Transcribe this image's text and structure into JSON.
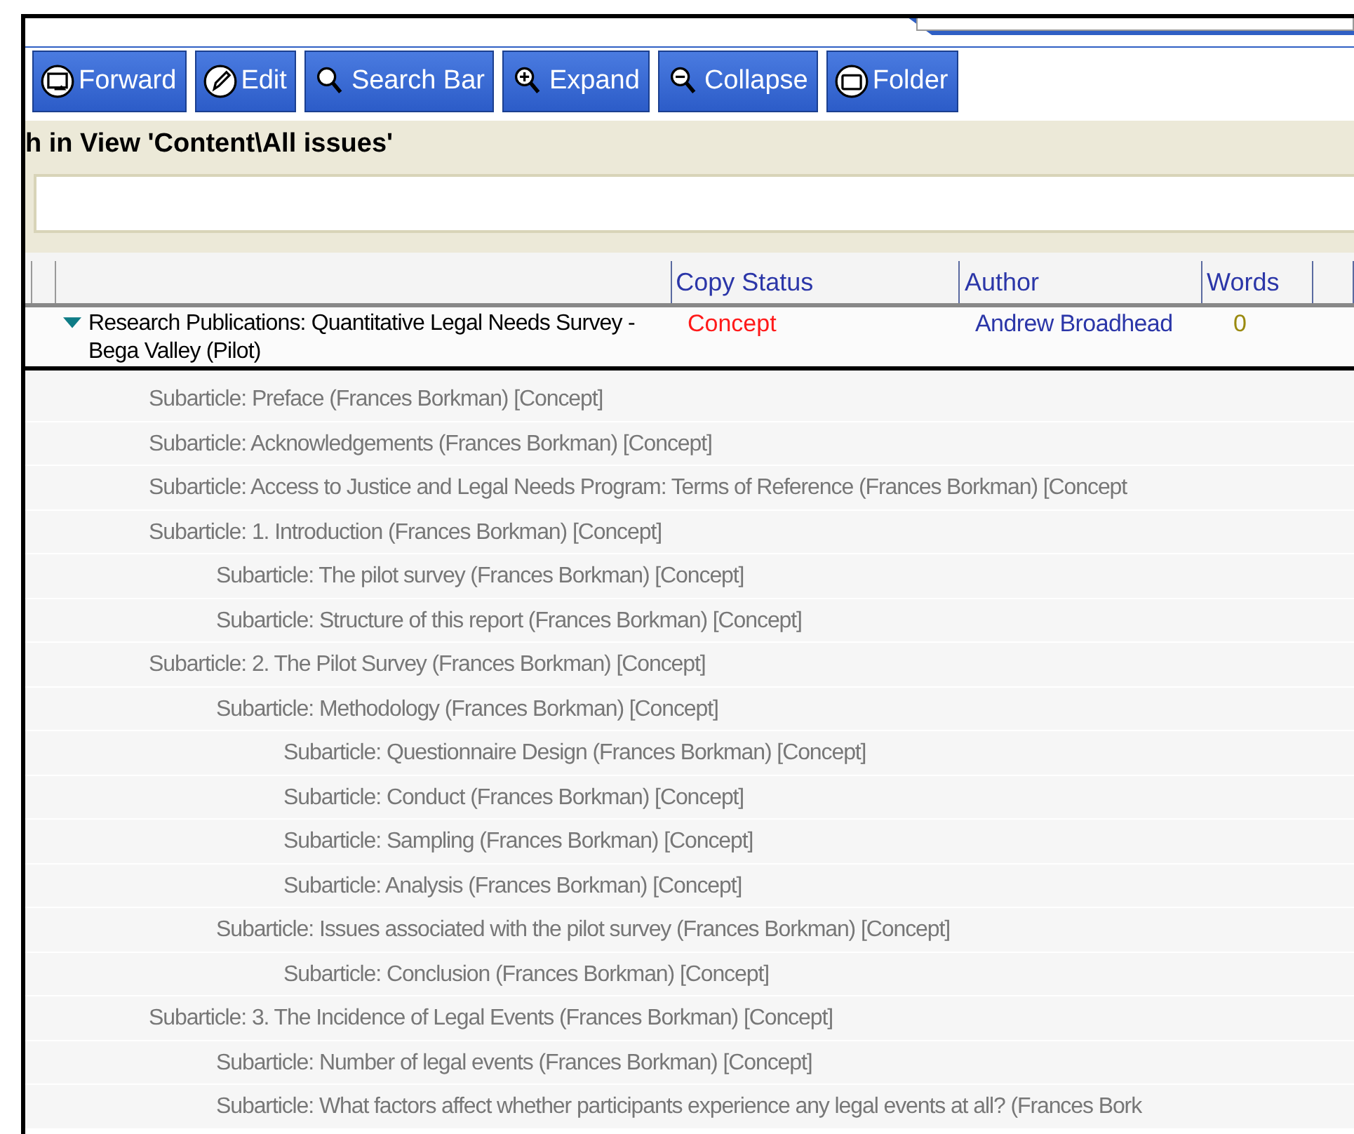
{
  "toolbar": {
    "buttons": [
      {
        "label": "Forward",
        "kind": "forward"
      },
      {
        "label": "Edit",
        "kind": "edit"
      },
      {
        "label": "Search Bar",
        "kind": "search"
      },
      {
        "label": "Expand",
        "kind": "expand"
      },
      {
        "label": "Collapse",
        "kind": "collapse"
      },
      {
        "label": "Folder",
        "kind": "folder"
      }
    ]
  },
  "view_title": "h in View 'Content\\All issues'",
  "table": {
    "columns": [
      "Copy Status",
      "Author",
      "Words"
    ],
    "rows": [
      {
        "title": "Research Publications: Quantitative Legal Needs Survey - Bega Valley (Pilot)",
        "expanded": true,
        "copy_status": "Concept",
        "author": "Andrew Broadhead",
        "words": "0",
        "children": [
          {
            "text": "Subarticle: Preface (Frances Borkman) [Concept]"
          },
          {
            "text": "Subarticle: Acknowledgements (Frances Borkman) [Concept]"
          },
          {
            "text": "Subarticle: Access to Justice and Legal Needs Program: Terms of Reference (Frances Borkman) [Concept"
          },
          {
            "text": "Subarticle: 1. Introduction (Frances Borkman) [Concept]",
            "children": [
              {
                "text": "Subarticle: The pilot survey (Frances Borkman) [Concept]"
              },
              {
                "text": "Subarticle: Structure of this report (Frances Borkman) [Concept]"
              }
            ]
          },
          {
            "text": "Subarticle: 2. The Pilot Survey (Frances Borkman) [Concept]",
            "children": [
              {
                "text": "Subarticle: Methodology (Frances Borkman) [Concept]",
                "children": [
                  {
                    "text": "Subarticle: Questionnaire Design (Frances Borkman) [Concept]"
                  },
                  {
                    "text": "Subarticle: Conduct (Frances Borkman) [Concept]"
                  },
                  {
                    "text": "Subarticle: Sampling (Frances Borkman) [Concept]"
                  },
                  {
                    "text": "Subarticle: Analysis (Frances Borkman) [Concept]"
                  }
                ]
              },
              {
                "text": "Subarticle: Issues associated with the pilot survey (Frances Borkman) [Concept]",
                "children": [
                  {
                    "text": "Subarticle: Conclusion (Frances Borkman) [Concept]"
                  }
                ]
              }
            ]
          },
          {
            "text": "Subarticle: 3. The Incidence of Legal Events (Frances Borkman) [Concept]",
            "children": [
              {
                "text": "Subarticle: Number of legal events  (Frances Borkman) [Concept]"
              },
              {
                "text": "Subarticle: What factors affect whether participants experience any legal events at all? (Frances Bork"
              }
            ]
          }
        ]
      }
    ]
  }
}
